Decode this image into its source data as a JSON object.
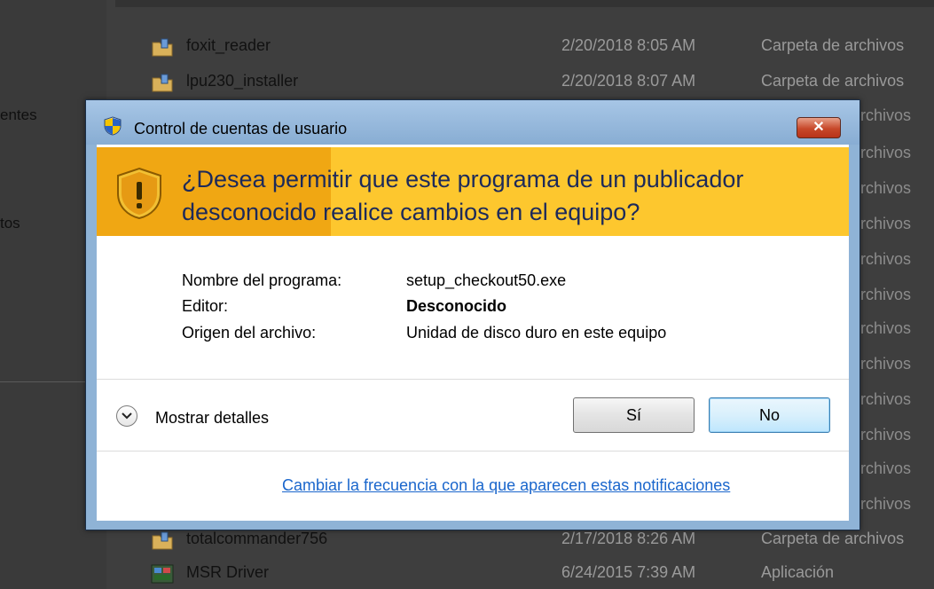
{
  "background": {
    "nav_items": [
      "entes",
      "tos"
    ],
    "files": [
      {
        "name": "foxit_reader",
        "date": "2/20/2018 8:05 AM",
        "type": "Carpeta de archivos",
        "icon": "folder-installer-icon"
      },
      {
        "name": "lpu230_installer",
        "date": "2/20/2018 8:07 AM",
        "type": "Carpeta de archivos",
        "icon": "folder-installer-icon"
      },
      {
        "name": "totalcommander756",
        "date": "2/17/2018 8:26 AM",
        "type": "Carpeta de archivos",
        "icon": "folder-installer-icon"
      },
      {
        "name": "MSR Driver",
        "date": "6/24/2015 7:39 AM",
        "type": "Aplicación",
        "icon": "application-icon"
      }
    ],
    "hidden_type_labels": [
      "archivos",
      "archivos",
      "archivos",
      "archivos",
      "archivos",
      "archivos",
      "archivos",
      "archivos",
      "archivos",
      "archivos",
      "archivos",
      "archivos"
    ]
  },
  "dialog": {
    "title": "Control de cuentas de usuario",
    "close_label": "✕",
    "question_line1": "¿Desea permitir que este programa de un publicador",
    "question_line2": "desconocido realice cambios en el equipo?",
    "details": [
      {
        "label": "Nombre del programa:",
        "value": "setup_checkout50.exe",
        "bold": false
      },
      {
        "label": "Editor:",
        "value": "Desconocido",
        "bold": true
      },
      {
        "label": "Origen del archivo:",
        "value": "Unidad de disco duro en este equipo",
        "bold": false
      }
    ],
    "show_details_label": "Mostrar detalles",
    "yes_label": "Sí",
    "no_label": "No",
    "notification_link": "Cambiar la frecuencia con la que aparecen estas notificaciones"
  },
  "colors": {
    "banner_yellow": "#fdc72e",
    "banner_dark_yellow": "#f0a713",
    "title_bar": "#a7c6e6",
    "link": "#1a66cc",
    "close_red": "#c7482a"
  }
}
